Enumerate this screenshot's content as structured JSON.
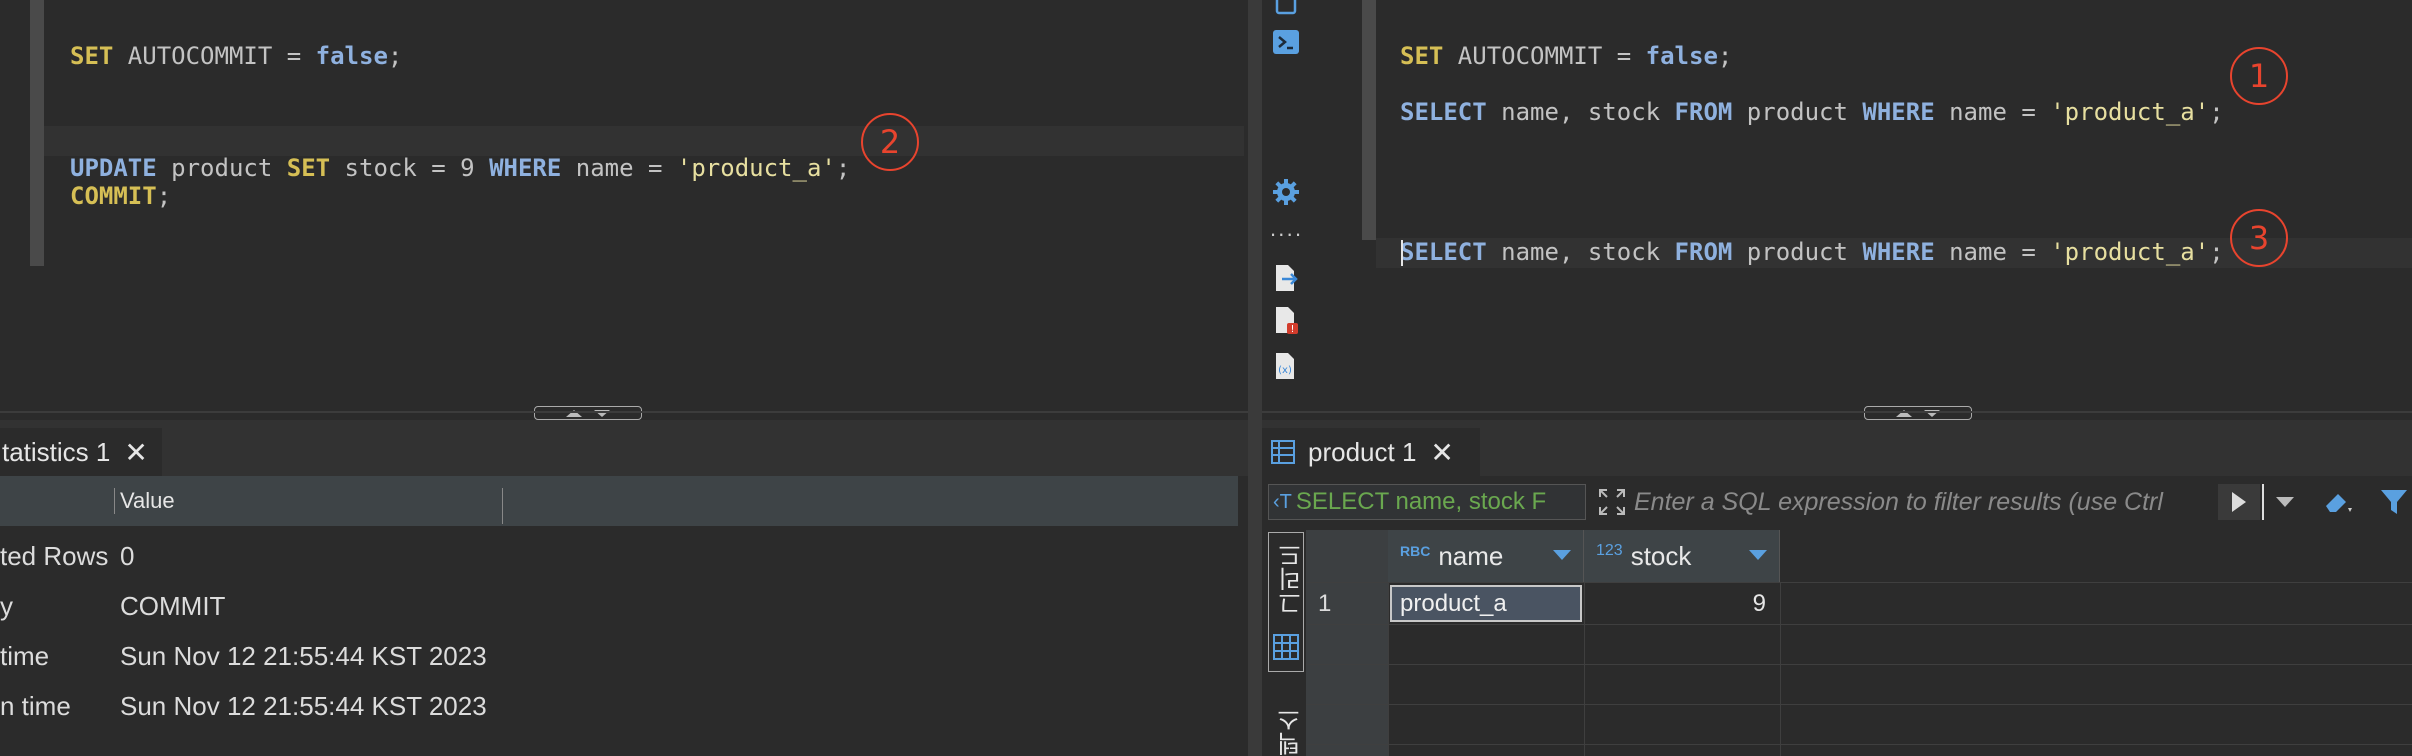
{
  "left_editor": {
    "line1": {
      "kw1": "SET",
      "ident": " AUTOCOMMIT = ",
      "val": "false",
      "end": ";"
    },
    "line2": {
      "kw1": "UPDATE",
      "t1": " product ",
      "kw2": "SET",
      "t2": " stock = 9 ",
      "kw3": "WHERE",
      "t3": " name = ",
      "str": "'product_a'",
      "end": ";"
    },
    "line3": {
      "kw1": "COMMIT",
      "end": ";"
    },
    "marker": "2"
  },
  "right_editor": {
    "line1": {
      "kw1": "SET",
      "ident": " AUTOCOMMIT = ",
      "val": "false",
      "end": ";"
    },
    "line2": {
      "kw1": "SELECT",
      "t1": " name, stock ",
      "kw2": "FROM",
      "t2": " product ",
      "kw3": "WHERE",
      "t3": " name = ",
      "str": "'product_a'",
      "end": ";"
    },
    "line3": {
      "kw1": "SELECT",
      "t1": " name, stock ",
      "kw2": "FROM",
      "t2": " product ",
      "kw3": "WHERE",
      "t3": " name = ",
      "str": "'product_a'",
      "end": ";"
    },
    "marker1": "1",
    "marker3": "3"
  },
  "left_results": {
    "tab_label": "tatistics 1",
    "header": {
      "col1": "",
      "col2": "Value"
    },
    "rows": [
      {
        "name": "ted Rows",
        "value": "0"
      },
      {
        "name": "y",
        "value": "COMMIT"
      },
      {
        "name": " time",
        "value": "Sun Nov 12 21:55:44 KST 2023"
      },
      {
        "name": "n time",
        "value": "Sun Nov 12 21:55:44 KST 2023"
      }
    ]
  },
  "right_results": {
    "tab_label": "product 1",
    "sql_filter_label": "SELECT name, stock F",
    "filter_placeholder": "Enter a SQL expression to filter results (use Ctrl",
    "side_tab_grid": "그리드",
    "side_tab_text": "텍스트",
    "columns": [
      {
        "type": "RBC",
        "name": "name"
      },
      {
        "type": "123",
        "name": "stock"
      }
    ],
    "rows": [
      {
        "num": "1",
        "name": "product_a",
        "stock": "9"
      }
    ]
  },
  "colors": {
    "keyword_yellow": "#d6bf55",
    "keyword_blue": "#8fb1df",
    "marker_red": "#e8442e",
    "filter_green": "#6aa84f"
  }
}
